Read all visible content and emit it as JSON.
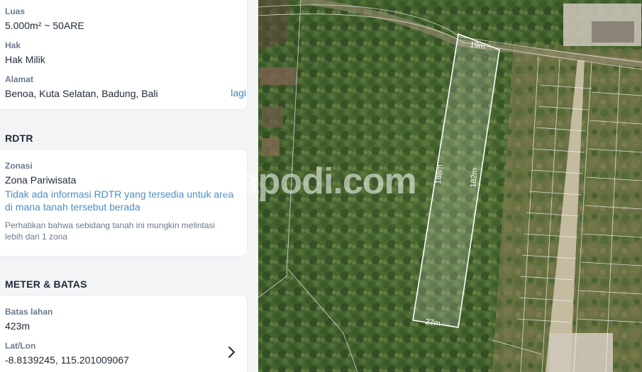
{
  "details": {
    "luas_label": "Luas",
    "luas_value": "5.000m² ~ 50ARE",
    "hak_label": "Hak",
    "hak_value": "Hak Milik",
    "alamat_label": "Alamat",
    "alamat_value": "Benoa, Kuta Selatan, Badung, Bali",
    "more_link": "lagi"
  },
  "rdtr": {
    "section_title": "RDTR",
    "zonasi_label": "Zonasi",
    "zonasi_value": "Zona Pariwisata",
    "info_text": "Tidak ada informasi RDTR yang tersedia untuk area di mana tanah tersebut berada",
    "note": "Perhatikan bahwa sebidang tanah ini mungkin melintasi lebih dari 1 zona"
  },
  "meter": {
    "section_title": "METER & BATAS",
    "batas_label": "Batas lahan",
    "batas_value": "423m",
    "latlon_label": "Lat/Lon",
    "latlon_value": "-8.8139245, 115.201009067"
  },
  "map": {
    "watermark": "dapodi.com",
    "dims": {
      "top": "19m",
      "left": "188m",
      "right": "182m",
      "bottom": "27m"
    },
    "icons": {
      "chevron": "chevron-right-icon"
    }
  }
}
